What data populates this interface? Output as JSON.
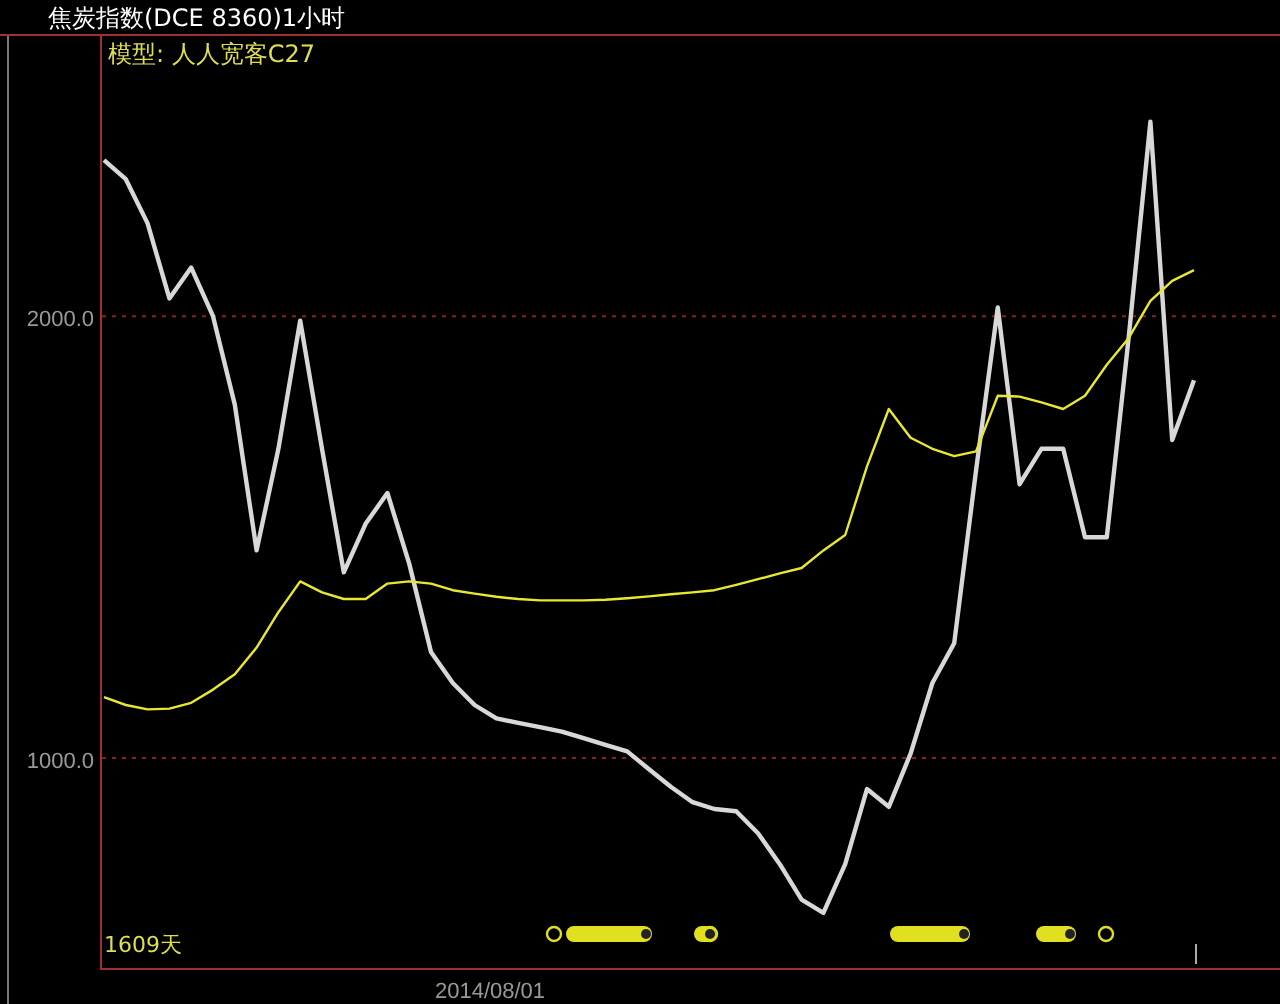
{
  "title": "焦炭指数(DCE 8360)1小时",
  "model_label": "模型: 人人宽客C27",
  "span_label": "1609天",
  "date_label": "2014/08/01",
  "chart_data": {
    "type": "line",
    "ylim": [
      525,
      2634
    ],
    "yticks": [
      {
        "value": 1000,
        "label": "1000.0"
      },
      {
        "value": 2000,
        "label": "2000.0"
      }
    ],
    "series": [
      {
        "color": "#d8d8d8",
        "values": [
          2353,
          2310,
          2210,
          2040,
          2110,
          2000,
          1800,
          1470,
          1700,
          1990,
          1700,
          1420,
          1530,
          1600,
          1440,
          1240,
          1170,
          1120,
          1090,
          1080,
          1070,
          1060,
          1045,
          1030,
          1015,
          975,
          935,
          900,
          885,
          880,
          830,
          760,
          680,
          650,
          760,
          930,
          890,
          1010,
          1170,
          1260,
          1650,
          2020,
          1620,
          1700,
          1700,
          1500,
          1500,
          1950,
          2440,
          1720,
          1855
        ]
      },
      {
        "color": "#e8e830",
        "values": [
          1138,
          1120,
          1110,
          1112,
          1125,
          1155,
          1190,
          1250,
          1330,
          1400,
          1375,
          1360,
          1360,
          1395,
          1400,
          1395,
          1380,
          1372,
          1365,
          1360,
          1357,
          1357,
          1357,
          1358,
          1362,
          1366,
          1371,
          1375,
          1380,
          1392,
          1405,
          1418,
          1430,
          1470,
          1505,
          1660,
          1790,
          1725,
          1700,
          1683,
          1694,
          1820,
          1818,
          1805,
          1790,
          1820,
          1890,
          1950,
          2035,
          2080,
          2104
        ]
      }
    ]
  }
}
